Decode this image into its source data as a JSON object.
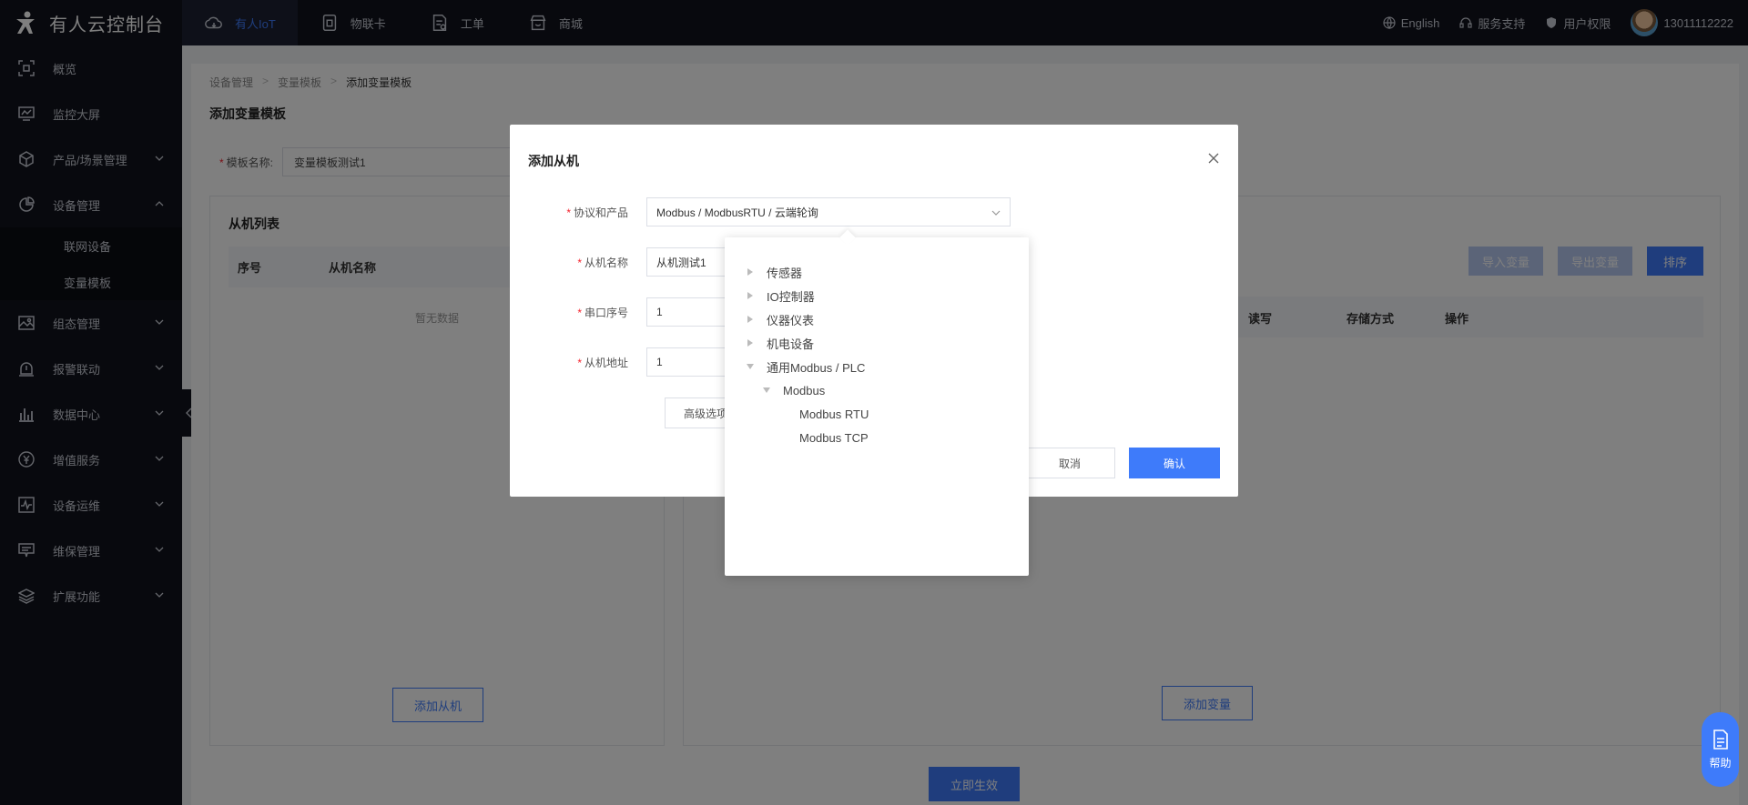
{
  "topbar": {
    "brand": "有人云控制台",
    "nav": [
      {
        "label": "有人IoT",
        "icon": "cloud-icon"
      },
      {
        "label": "物联卡",
        "icon": "sim-card-icon"
      },
      {
        "label": "工单",
        "icon": "ticket-icon"
      },
      {
        "label": "商城",
        "icon": "store-icon"
      }
    ],
    "language": "English",
    "support": "服务支持",
    "permissions": "用户权限",
    "user": "13011112222"
  },
  "sidebar": {
    "items": [
      {
        "label": "概览"
      },
      {
        "label": "监控大屏"
      },
      {
        "label": "产品/场景管理"
      },
      {
        "label": "设备管理"
      },
      {
        "label": "组态管理"
      },
      {
        "label": "报警联动"
      },
      {
        "label": "数据中心"
      },
      {
        "label": "增值服务"
      },
      {
        "label": "设备运维"
      },
      {
        "label": "维保管理"
      },
      {
        "label": "扩展功能"
      }
    ],
    "sub_items": [
      "联网设备",
      "变量模板"
    ]
  },
  "page": {
    "breadcrumb": [
      "设备管理",
      "变量模板",
      "添加变量模板"
    ],
    "title": "添加变量模板",
    "template_label": "模板名称:",
    "template_value": "变量模板测试1",
    "left_panel_title": "从机列表",
    "left_cols": [
      "序号",
      "从机名称"
    ],
    "empty": "暂无数据",
    "add_slave": "添加从机",
    "import_var": "导入变量",
    "export_var": "导出变量",
    "sort": "排序",
    "right_cols": [
      "读写",
      "存储方式",
      "操作"
    ],
    "add_var": "添加变量",
    "apply": "立即生效",
    "help": "帮助"
  },
  "modal": {
    "title": "添加从机",
    "protocol_label": "协议和产品",
    "protocol_value": "Modbus / ModbusRTU / 云端轮询",
    "name_label": "从机名称",
    "name_value": "从机测试1",
    "serial_label": "串口序号",
    "serial_value": "1",
    "address_label": "从机地址",
    "address_value": "1",
    "advanced": "高级选项",
    "cancel": "取消",
    "confirm": "确认"
  },
  "cascader": {
    "l1": [
      "传感器",
      "IO控制器",
      "仪器仪表",
      "机电设备",
      "通用Modbus / PLC"
    ],
    "l2": "Modbus",
    "l3": [
      "Modbus RTU",
      "Modbus TCP"
    ]
  },
  "colors": {
    "accent": "#3e7bfa",
    "nav_bg": "#11131c"
  }
}
